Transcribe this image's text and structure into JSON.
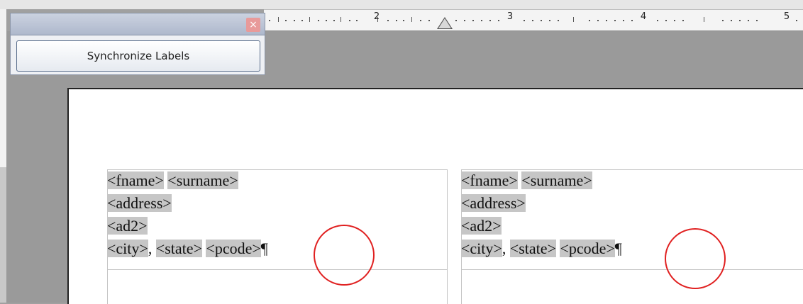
{
  "toolbar": {
    "close_icon": "×",
    "sync_button": "Synchronize Labels"
  },
  "ruler": {
    "numbers": [
      "2",
      "3",
      "4",
      "5"
    ]
  },
  "labels": [
    {
      "fname": "<fname>",
      "surname": "<surname>",
      "address": "<address>",
      "ad2": "<ad2>",
      "city": "<city>",
      "comma": ",",
      "state": "<state>",
      "pcode": "<pcode>",
      "pilcrow": "¶"
    },
    {
      "fname": "<fname>",
      "surname": "<surname>",
      "address": "<address>",
      "ad2": "<ad2>",
      "city": "<city>",
      "comma": ",",
      "state": "<state>",
      "pcode": "<pcode>",
      "pilcrow": "¶"
    }
  ],
  "annotation_color": "#e02020",
  "field_highlight_color": "#c6c6c6"
}
